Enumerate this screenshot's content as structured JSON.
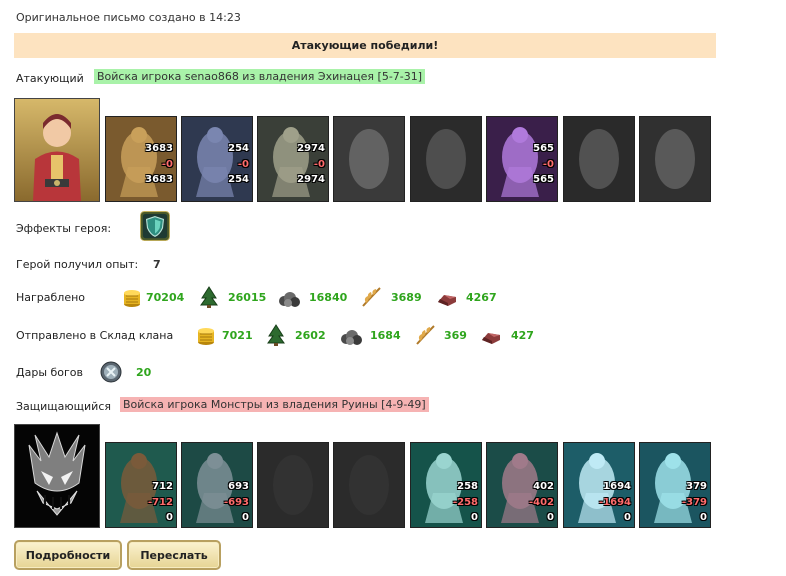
{
  "header": {
    "created_text": "Оригинальное письмо создано в 14:23",
    "banner": "Атакующие победили!"
  },
  "attacker": {
    "label": "Атакующий",
    "army": "Войска игрока senao868 из владения Эхинацея [5-7-31]",
    "units": [
      {
        "icon": "golem-unit-icon",
        "count": "3683",
        "lost": "-0",
        "left": "3683"
      },
      {
        "icon": "assassin-unit-icon",
        "count": "254",
        "lost": "-0",
        "left": "254"
      },
      {
        "icon": "dragon-knight-unit-icon",
        "count": "2974",
        "lost": "-0",
        "left": "2974"
      },
      {
        "icon": "griffin-unit-icon-empty",
        "count": "",
        "lost": "",
        "left": ""
      },
      {
        "icon": "archer-unit-icon-empty",
        "count": "",
        "lost": "",
        "left": ""
      },
      {
        "icon": "warlock-unit-icon",
        "count": "565",
        "lost": "-0",
        "left": "565"
      },
      {
        "icon": "reaper-unit-icon-empty",
        "count": "",
        "lost": "",
        "left": ""
      },
      {
        "icon": "spider-unit-icon-empty",
        "count": "",
        "lost": "",
        "left": ""
      }
    ],
    "hero_effects_label": "Эффекты героя:",
    "experience_label": "Герой получил опыт:",
    "experience_value": "7",
    "loot_label": "Награблено",
    "loot": [
      "70204",
      "26015",
      "16840",
      "3689",
      "4267"
    ],
    "clan_label": "Отправлено в Склад клана",
    "clan": [
      "7021",
      "2602",
      "1684",
      "369",
      "427"
    ],
    "gods_label": "Дары богов",
    "gods_value": "20"
  },
  "defender": {
    "label": "Защищающийся",
    "army": "Войска игрока Монстры из владения Руины [4-9-49]",
    "units": [
      {
        "icon": "worm-unit-icon",
        "count": "712",
        "lost": "-712",
        "left": "0"
      },
      {
        "icon": "troll-unit-icon",
        "count": "693",
        "lost": "-693",
        "left": "0"
      },
      {
        "icon": "empty-slot-icon",
        "count": "",
        "lost": "",
        "left": ""
      },
      {
        "icon": "empty-slot-icon",
        "count": "",
        "lost": "",
        "left": ""
      },
      {
        "icon": "crab-unit-icon",
        "count": "258",
        "lost": "-258",
        "left": "0"
      },
      {
        "icon": "naga-unit-icon",
        "count": "402",
        "lost": "-402",
        "left": "0"
      },
      {
        "icon": "crystal-unit-icon",
        "count": "1694",
        "lost": "-1694",
        "left": "0"
      },
      {
        "icon": "ice-demon-unit-icon",
        "count": "379",
        "lost": "-379",
        "left": "0"
      }
    ]
  },
  "buttons": {
    "details": "Подробности",
    "forward": "Переслать"
  },
  "colors": {
    "banner": "#fde3c0",
    "attacker_tag": "#a9f2a9",
    "defender_tag": "#f6b3b3",
    "resource_value": "#2fa51d"
  }
}
